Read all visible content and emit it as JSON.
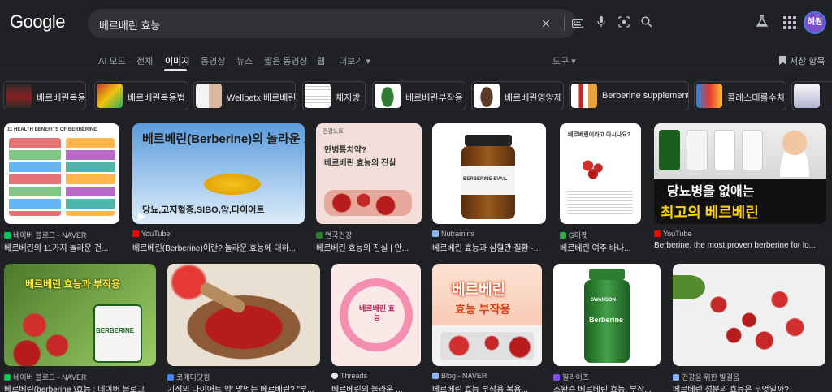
{
  "header": {
    "logo": "Google",
    "query": "베르베린 효능",
    "avatar": "혜원"
  },
  "tabs": [
    "AI 모드",
    "전체",
    "이미지",
    "동영상",
    "뉴스",
    "짧은 동영상",
    "웹",
    "더보기 ▾"
  ],
  "tools": "도구 ▾",
  "saved": "저장 항목",
  "chips": [
    "베르베린복용",
    "베르베린복용법",
    "Wellbetx 베르베린",
    "체지방",
    "베르베린부작용",
    "베르베린영양제",
    "Berberine supplement",
    "콜레스테롤수치"
  ],
  "colors": {
    "accent": "#8ab4f8",
    "background": "#202124"
  },
  "results_row1": [
    {
      "source": "네이버 블로그 - NAVER",
      "title": "베르베린의 11가지 놀라운 건...",
      "overlay": "11 HEALTH BENEFITS OF BERBERINE"
    },
    {
      "source": "YouTube",
      "title": "베르베린(Berberine)이란? 놀라운 효능에 대하...",
      "overlay": "베르베린(Berberine)의 놀라운 효능!!",
      "overlay2": "당뇨,고지혈증,SIBO,암,다이어트"
    },
    {
      "source": "연국건강",
      "title": "베르베린 효능의 진실 | 안...",
      "overlay": "건강노트",
      "overlay2": "만병통치약?",
      "overlay3": "베르베린 효능의 진실"
    },
    {
      "source": "Nutramins",
      "title": "베르베린 효능과 심혈관 질환 -...",
      "overlay": "BERBERINE-EVAIL"
    },
    {
      "source": "G마켓",
      "title": "베르베린 여주 바나...",
      "overlay": "베르베린이라고 아시나요?"
    },
    {
      "source": "YouTube",
      "title": "Berberine, the most proven berberine for lo...",
      "overlay": "당뇨병을 없애는",
      "overlay2": "최고의 베르베린"
    }
  ],
  "results_row2": [
    {
      "source": "네이버 블로그 - NAVER",
      "title": "베르베린(berberine )효능 : 네이버 블로그",
      "overlay": "베르베린 효능과 부작용",
      "overlay2": "BERBERINE"
    },
    {
      "source": "코메디닷컴",
      "title": "기적의 다이어트 약' 맞먹는 베르베린? \"부..."
    },
    {
      "source": "Threads",
      "title": "베르베린의 놀라운 ...",
      "overlay": "베르베린 효능"
    },
    {
      "source": "Blog - NAVER",
      "title": "베르베린 효능 부작용 복용...",
      "overlay": "베르베린",
      "overlay2": "효능 부작용"
    },
    {
      "source": "필라이즈",
      "title": "스완슨 베르베린 효능, 부작...",
      "overlay": "SWANSON",
      "overlay2": "Berberine"
    },
    {
      "source": "건강을 위한 발걸음",
      "title": "베르베린 성분의 효능은 무엇일까?"
    }
  ]
}
